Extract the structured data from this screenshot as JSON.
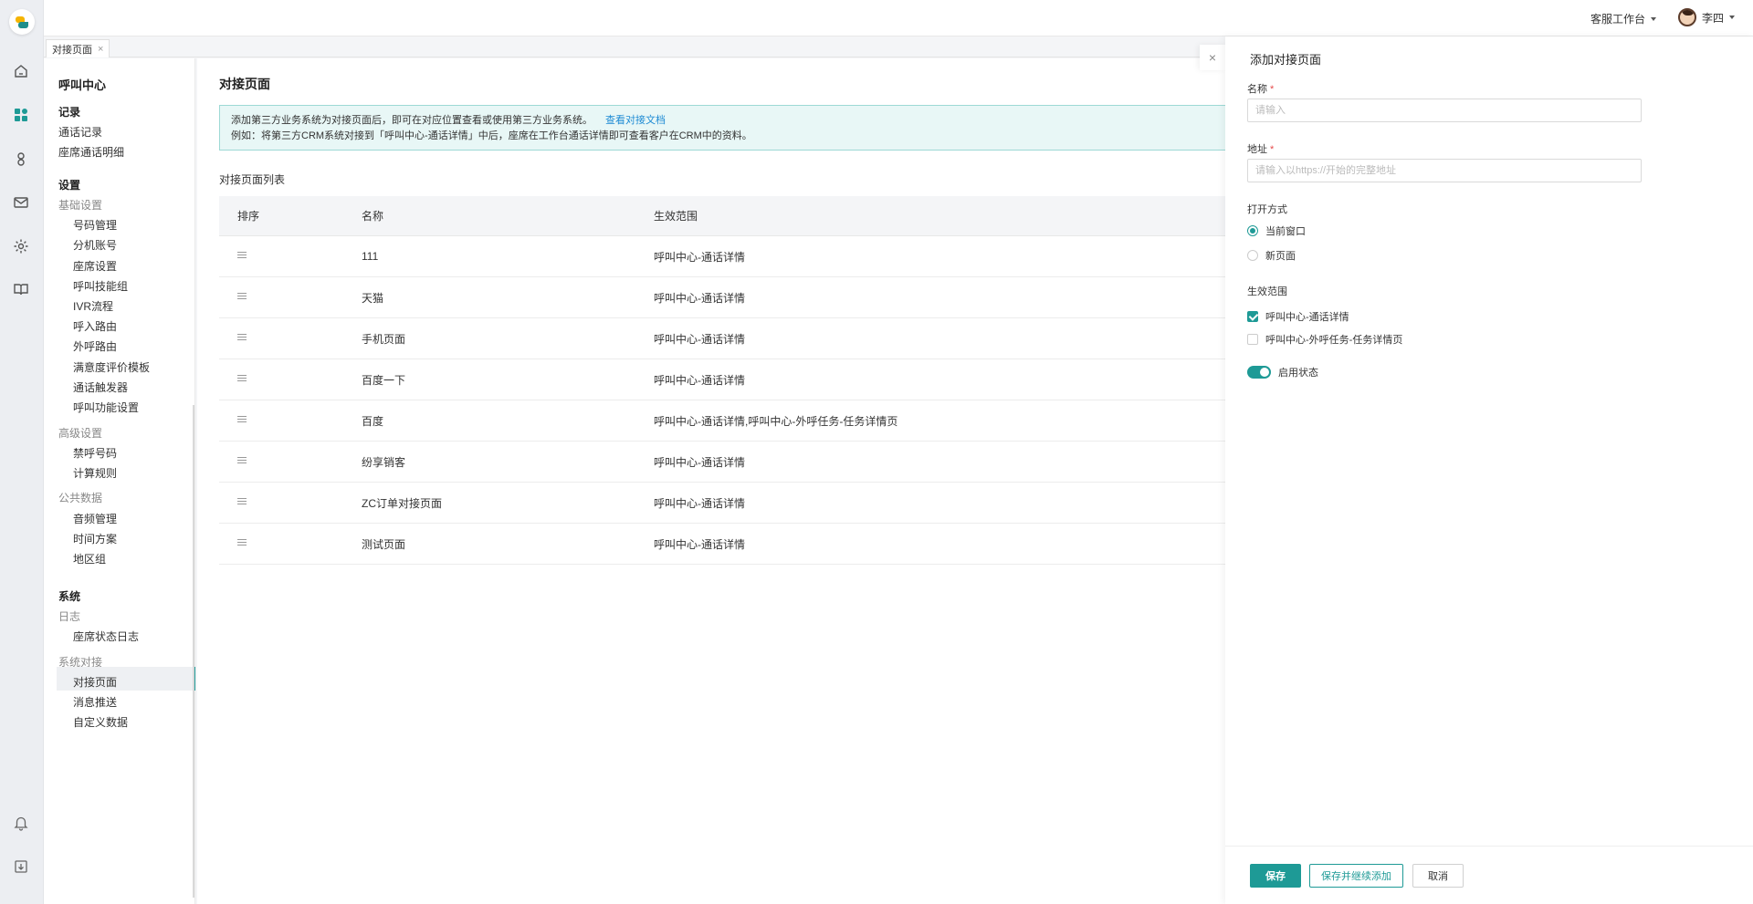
{
  "header": {
    "workspace": "客服工作台",
    "user_name": "李四"
  },
  "tabs": [
    {
      "label": "对接页面",
      "close": "×"
    }
  ],
  "rail": {
    "icons": [
      "home-icon",
      "dashboard-icon",
      "contacts-icon",
      "mail-icon",
      "settings-icon",
      "book-icon",
      "bell-icon",
      "download-icon"
    ]
  },
  "menu": {
    "title": "呼叫中心",
    "record": {
      "label": "记录",
      "items": [
        "通话记录",
        "座席通话明细"
      ]
    },
    "settings": {
      "label": "设置",
      "basic": {
        "label": "基础设置",
        "items": [
          "号码管理",
          "分机账号",
          "座席设置",
          "呼叫技能组",
          "IVR流程",
          "呼入路由",
          "外呼路由",
          "满意度评价模板",
          "通话触发器",
          "呼叫功能设置"
        ]
      },
      "advanced": {
        "label": "高级设置",
        "items": [
          "禁呼号码",
          "计算规则"
        ]
      },
      "public": {
        "label": "公共数据",
        "items": [
          "音频管理",
          "时间方案",
          "地区组"
        ]
      }
    },
    "system": {
      "label": "系统",
      "log": {
        "label": "日志",
        "items": [
          "座席状态日志"
        ]
      },
      "integration": {
        "label": "系统对接",
        "items": [
          "对接页面",
          "消息推送",
          "自定义数据"
        ]
      }
    }
  },
  "main": {
    "title": "对接页面",
    "notice_line1": "添加第三方业务系统为对接页面后，即可在对应位置查看或使用第三方业务系统。",
    "notice_link": "查看对接文档",
    "notice_line2": "例如：将第三方CRM系统对接到「呼叫中心-通话详情」中后，座席在工作台通话详情即可查看客户在CRM中的资料。",
    "list_label": "对接页面列表",
    "columns": [
      "排序",
      "名称",
      "生效范围"
    ],
    "rows": [
      {
        "name": "111",
        "scope": "呼叫中心-通话详情"
      },
      {
        "name": "天猫",
        "scope": "呼叫中心-通话详情"
      },
      {
        "name": "手机页面",
        "scope": "呼叫中心-通话详情"
      },
      {
        "name": "百度一下",
        "scope": "呼叫中心-通话详情"
      },
      {
        "name": "百度",
        "scope": "呼叫中心-通话详情,呼叫中心-外呼任务-任务详情页"
      },
      {
        "name": "纷享销客",
        "scope": "呼叫中心-通话详情"
      },
      {
        "name": "ZC订单对接页面",
        "scope": "呼叫中心-通话详情"
      },
      {
        "name": "测试页面",
        "scope": "呼叫中心-通话详情"
      }
    ]
  },
  "drawer": {
    "title": "添加对接页面",
    "close": "×",
    "name_label": "名称",
    "name_placeholder": "请输入",
    "name_value": "",
    "address_label": "地址",
    "address_placeholder": "请输入以https://开始的完整地址",
    "address_value": "",
    "required_mark": "*",
    "open_mode_label": "打开方式",
    "open_modes": [
      {
        "label": "当前窗口",
        "selected": true
      },
      {
        "label": "新页面",
        "selected": false
      }
    ],
    "scope_label": "生效范围",
    "scopes": [
      {
        "label": "呼叫中心-通话详情",
        "checked": true
      },
      {
        "label": "呼叫中心-外呼任务-任务详情页",
        "checked": false
      }
    ],
    "status_label": "启用状态",
    "status_on": true,
    "buttons": {
      "save": "保存",
      "save_continue": "保存并继续添加",
      "cancel": "取消"
    }
  },
  "colors": {
    "accent": "#1e9a96",
    "link": "#1e8bd4",
    "required": "#e64b4b"
  }
}
